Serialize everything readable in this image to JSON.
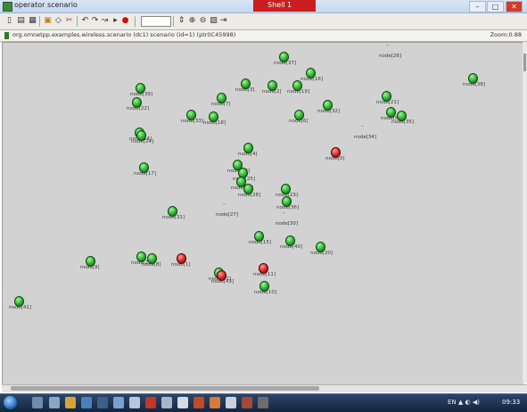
{
  "window": {
    "title": "operator scenario",
    "active_caption": "Shell 1",
    "min_label": "–",
    "max_label": "□",
    "close_label": "✕"
  },
  "toolbar": {
    "icons": [
      "new-icon",
      "open-icon",
      "save-icon",
      "print-icon",
      "cut-icon",
      "settings-icon",
      "undo-icon",
      "redo-icon",
      "step-icon",
      "play-icon",
      "stop-icon",
      "speed-field",
      "zoom-in-icon",
      "zoom-out-icon",
      "zoom-reset-icon",
      "fit-icon"
    ]
  },
  "status": {
    "path": "org.omnetpp.examples.wireless.scenario  (dc1)  scenario  (id=1)  (ptr0C45998)",
    "zoom": "Zoom:0.88"
  },
  "nodes": [
    {
      "label": "node[37]",
      "color": "green"
    },
    {
      "label": "node[26]",
      "color": "none"
    },
    {
      "label": "node[38]",
      "color": "green"
    },
    {
      "label": "node[16]",
      "color": "green"
    },
    {
      "label": "node[3]",
      "color": "green"
    },
    {
      "label": "node[2]",
      "color": "green"
    },
    {
      "label": "node[19]",
      "color": "green"
    },
    {
      "label": "node[7]",
      "color": "green"
    },
    {
      "label": "node[33]",
      "color": "green"
    },
    {
      "label": "node[18]",
      "color": "green"
    },
    {
      "label": "node[39]",
      "color": "green"
    },
    {
      "label": "node[22]",
      "color": "green"
    },
    {
      "label": "node[21]",
      "color": "green"
    },
    {
      "label": "node[5]",
      "color": "green"
    },
    {
      "label": "node[35]",
      "color": "green"
    },
    {
      "label": "node[32]",
      "color": "green"
    },
    {
      "label": "node[6]",
      "color": "green"
    },
    {
      "label": "node[34]",
      "color": "none"
    },
    {
      "label": "node[0]",
      "color": "red"
    },
    {
      "label": "node[14]",
      "color": "green"
    },
    {
      "label": "node[24]",
      "color": "green"
    },
    {
      "label": "node[17]",
      "color": "green"
    },
    {
      "label": "node[4]",
      "color": "green"
    },
    {
      "label": "node[12]",
      "color": "green"
    },
    {
      "label": "node[25]",
      "color": "green"
    },
    {
      "label": "node[13]",
      "color": "green"
    },
    {
      "label": "node[28]",
      "color": "green"
    },
    {
      "label": "node[27]",
      "color": "none"
    },
    {
      "label": "node[23]",
      "color": "green"
    },
    {
      "label": "node[30]",
      "color": "none"
    },
    {
      "label": "node[36]",
      "color": "green"
    },
    {
      "label": "node[31]",
      "color": "green"
    },
    {
      "label": "node[15]",
      "color": "green"
    },
    {
      "label": "node[40]",
      "color": "green"
    },
    {
      "label": "node[20]",
      "color": "green"
    },
    {
      "label": "node[9]",
      "color": "green"
    },
    {
      "label": "node[11]",
      "color": "red"
    },
    {
      "label": "node[10]",
      "color": "green"
    },
    {
      "label": "node[29]",
      "color": "green"
    },
    {
      "label": "node[8]",
      "color": "green"
    },
    {
      "label": "node[1]",
      "color": "red"
    },
    {
      "label": "node[42]",
      "color": "green"
    },
    {
      "label": "node[43]",
      "color": "red"
    },
    {
      "label": "node[41]",
      "color": "green"
    }
  ],
  "taskbar": {
    "tray": "EN  ▲  ◐  ◀)",
    "clock": "09:33"
  }
}
